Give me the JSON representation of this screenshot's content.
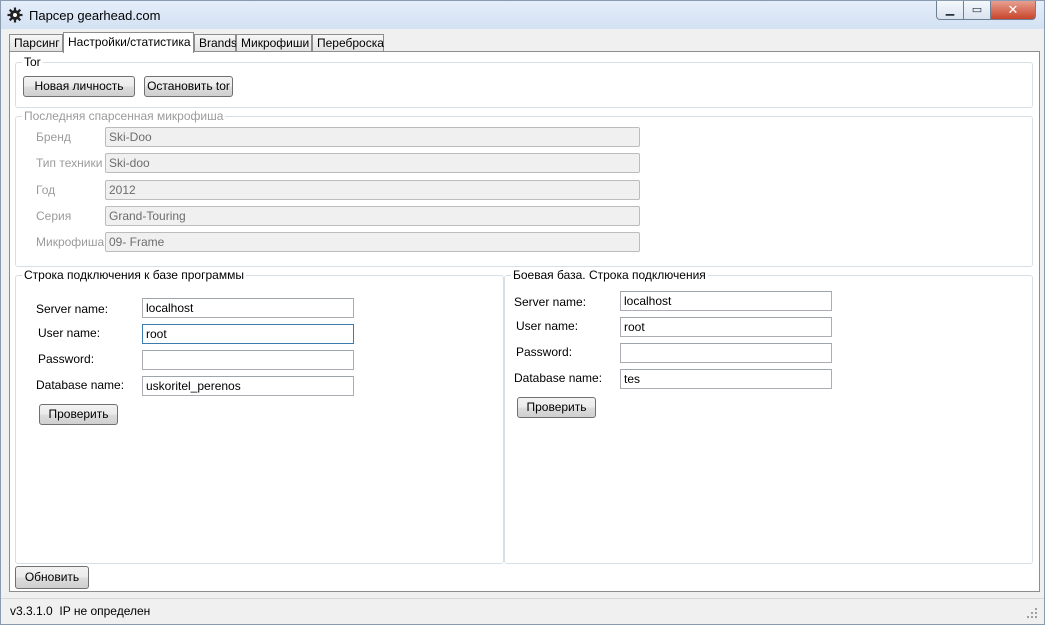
{
  "window": {
    "title": "Парсер gearhead.com"
  },
  "tabs": [
    {
      "label": "Парсинг",
      "active": false
    },
    {
      "label": "Настройки/статистика",
      "active": true
    },
    {
      "label": "Brands",
      "active": false
    },
    {
      "label": "Микрофиши",
      "active": false
    },
    {
      "label": "Переброска",
      "active": false
    }
  ],
  "tor": {
    "title": "Tor",
    "new_identity_label": "Новая личность",
    "stop_tor_label": "Остановить tor"
  },
  "last_microfiche": {
    "title": "Последняя спарсенная микрофиша",
    "fields": [
      {
        "label": "Бренд",
        "value": "Ski-Doo"
      },
      {
        "label": "Тип техники",
        "value": "Ski-doo"
      },
      {
        "label": "Год",
        "value": "2012"
      },
      {
        "label": "Серия",
        "value": "Grand-Touring"
      },
      {
        "label": "Микрофиша",
        "value": "09- Frame"
      }
    ]
  },
  "program_db": {
    "title": "Строка подключения к базе программы",
    "server_label": "Server name:",
    "server_value": "localhost",
    "user_label": "User name:",
    "user_value": "root",
    "password_label": "Password:",
    "password_value": "",
    "database_label": "Database name:",
    "database_value": "uskoritel_perenos",
    "check_label": "Проверить"
  },
  "prod_db": {
    "title": "Боевая база. Строка подключения",
    "server_label": "Server name:",
    "server_value": "localhost",
    "user_label": "User name:",
    "user_value": "root",
    "password_label": "Password:",
    "password_value": "",
    "database_label": "Database name:",
    "database_value": "tes",
    "check_label": "Проверить"
  },
  "refresh_label": "Обновить",
  "status": {
    "text": "v3.3.1.0  IP не определен"
  },
  "colors": {
    "titlebar": "#dbe6f4",
    "close_button": "#c8442c",
    "window_bg": "#f0f0f0"
  }
}
